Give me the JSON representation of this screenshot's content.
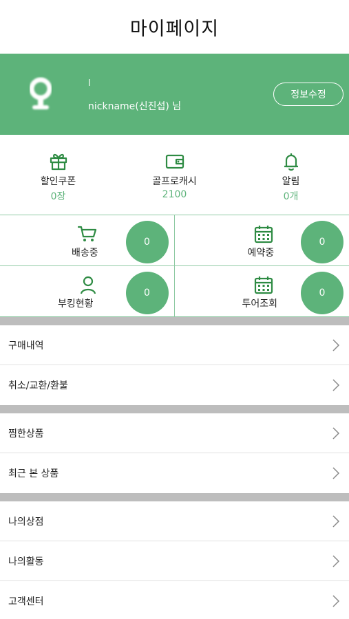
{
  "header": {
    "title": "마이페이지"
  },
  "profile": {
    "line1": "l",
    "nickname": "nickname(신진섭) 님",
    "edit_label": "정보수정"
  },
  "summary": [
    {
      "icon": "gift-icon",
      "label": "할인쿠폰",
      "value": "0장"
    },
    {
      "icon": "wallet-icon",
      "label": "골프로캐시",
      "value": "2100"
    },
    {
      "icon": "bell-icon",
      "label": "알림",
      "value": "0개"
    }
  ],
  "status": [
    {
      "icon": "cart-icon",
      "label": "배송중",
      "count": "0"
    },
    {
      "icon": "calendar-icon",
      "label": "예약중",
      "count": "0"
    },
    {
      "icon": "person-icon",
      "label": "부킹현황",
      "count": "0"
    },
    {
      "icon": "calendar-icon",
      "label": "투어조회",
      "count": "0"
    }
  ],
  "menu_groups": [
    [
      {
        "label": "구매내역"
      },
      {
        "label": "취소/교환/환불"
      }
    ],
    [
      {
        "label": "찜한상품"
      },
      {
        "label": "최근 본 상품"
      }
    ],
    [
      {
        "label": "나의상점"
      },
      {
        "label": "나의활동"
      },
      {
        "label": "고객센터"
      }
    ]
  ],
  "colors": {
    "accent": "#5db37a",
    "border": "#8fcaa3",
    "separator": "#bdbdbd"
  }
}
